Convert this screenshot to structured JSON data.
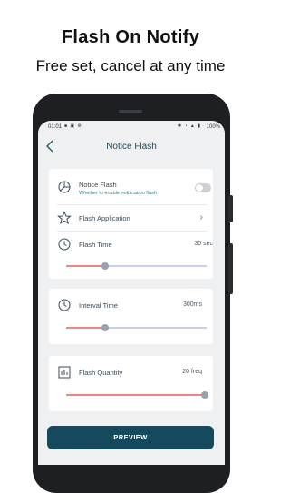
{
  "promo": {
    "headline": "Flash On Notify",
    "subline": "Free set, cancel at any time"
  },
  "status_bar": {
    "time": "01:01",
    "battery": "100%"
  },
  "app_bar": {
    "title": "Notice Flash",
    "back_icon": "back-arrow-icon"
  },
  "notice_card": {
    "notice_flash": {
      "label": "Notice Flash",
      "sublabel": "Whether to enable notification flash",
      "icon": "pie-chart-icon",
      "enabled": false
    },
    "flash_application": {
      "label": "Flash Application",
      "icon": "star-icon"
    },
    "flash_time": {
      "label": "Flash Time",
      "value": "30 sec",
      "icon": "clock-icon",
      "slider_fraction": 0.28
    }
  },
  "interval_card": {
    "label": "Interval Time",
    "value": "300ms",
    "icon": "clock-icon",
    "slider_fraction": 0.28
  },
  "quantity_card": {
    "label": "Flash Quantity",
    "value": "20 freq",
    "icon": "bar-chart-icon",
    "slider_fraction": 0.99
  },
  "preview_button": {
    "label": "PREVIEW"
  },
  "colors": {
    "accent": "#154a5e",
    "slider_active": "#ee8585",
    "slider_inactive": "#c9cdf0"
  }
}
